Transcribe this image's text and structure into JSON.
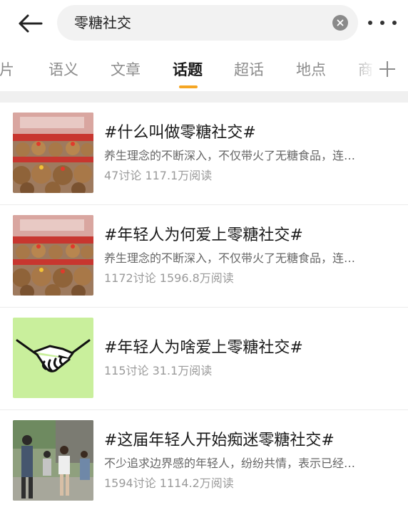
{
  "search": {
    "query": "零糖社交"
  },
  "tabs": [
    {
      "label": "图片"
    },
    {
      "label": "语义"
    },
    {
      "label": "文章"
    },
    {
      "label": "话题"
    },
    {
      "label": "超话"
    },
    {
      "label": "地点"
    },
    {
      "label": "商"
    }
  ],
  "active_tab": "话题",
  "icons": {
    "back": "arrow-left-icon",
    "clear": "clear-circle-icon",
    "more": "more-dots-icon",
    "add_tab": "plus-icon"
  },
  "colors": {
    "accent": "#f5a623",
    "handshake_bg": "#c9ef9c"
  },
  "topics": [
    {
      "title": "#什么叫做零糖社交#",
      "desc": "养生理念的不断深入，不仅带火了无糖食品，连…",
      "stats": "47讨论 117.1万阅读",
      "thumb": "plush-toys-image"
    },
    {
      "title": "#年轻人为何爱上零糖社交#",
      "desc": "养生理念的不断深入，不仅带火了无糖食品，连…",
      "stats": "1172讨论 1596.8万阅读",
      "thumb": "plush-toys-image"
    },
    {
      "title": "#年轻人为啥爱上零糖社交#",
      "desc": "",
      "stats": "115讨论 31.1万阅读",
      "thumb": "handshake-image"
    },
    {
      "title": "#这届年轻人开始痴迷零糖社交#",
      "desc": "不少追求边界感的年轻人，纷纷共情，表示已经…",
      "stats": "1594讨论 1114.2万阅读",
      "thumb": "people-photo-image"
    }
  ]
}
